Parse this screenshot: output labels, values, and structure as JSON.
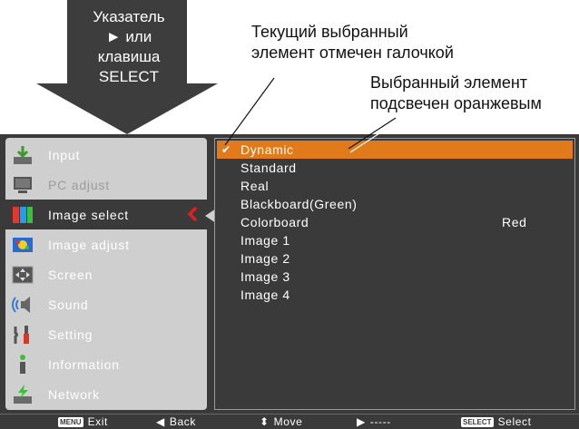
{
  "annotations": {
    "pointer_lines": [
      "Указатель",
      "► или",
      "клавиша",
      "SELECT"
    ],
    "current_selected_lines": [
      "Текущий выбранный",
      "элемент отмечен  галочкой"
    ],
    "highlight_lines": [
      "Выбранный элемент",
      "подсвечен оранжевым"
    ]
  },
  "sidebar": {
    "items": [
      {
        "label": "Input",
        "icon": "input-icon",
        "state": "normal"
      },
      {
        "label": "PC adjust",
        "icon": "pc-adjust-icon",
        "state": "disabled"
      },
      {
        "label": "Image select",
        "icon": "image-select-icon",
        "state": "active"
      },
      {
        "label": "Image adjust",
        "icon": "image-adjust-icon",
        "state": "normal"
      },
      {
        "label": "Screen",
        "icon": "screen-icon",
        "state": "normal"
      },
      {
        "label": "Sound",
        "icon": "sound-icon",
        "state": "normal"
      },
      {
        "label": "Setting",
        "icon": "setting-icon",
        "state": "normal"
      },
      {
        "label": "Information",
        "icon": "information-icon",
        "state": "normal"
      },
      {
        "label": "Network",
        "icon": "network-icon",
        "state": "normal"
      }
    ]
  },
  "options": [
    {
      "label": "Dynamic",
      "value": "",
      "selected": true,
      "checked": true
    },
    {
      "label": "Standard",
      "value": ""
    },
    {
      "label": "Real",
      "value": ""
    },
    {
      "label": "Blackboard(Green)",
      "value": ""
    },
    {
      "label": "Colorboard",
      "value": "Red"
    },
    {
      "label": "Image 1",
      "value": ""
    },
    {
      "label": "Image 2",
      "value": ""
    },
    {
      "label": "Image 3",
      "value": ""
    },
    {
      "label": "Image 4",
      "value": ""
    }
  ],
  "footer": {
    "exit_key": "MENU",
    "exit_label": "Exit",
    "back_label": "Back",
    "move_label": "Move",
    "next_label": "-----",
    "select_key": "SELECT",
    "select_label": "Select"
  },
  "colors": {
    "highlight": "#e07a1a",
    "menu_background": "#3a3a3a",
    "sidebar_background": "#cfcfcf",
    "chevron": "#e02020"
  }
}
